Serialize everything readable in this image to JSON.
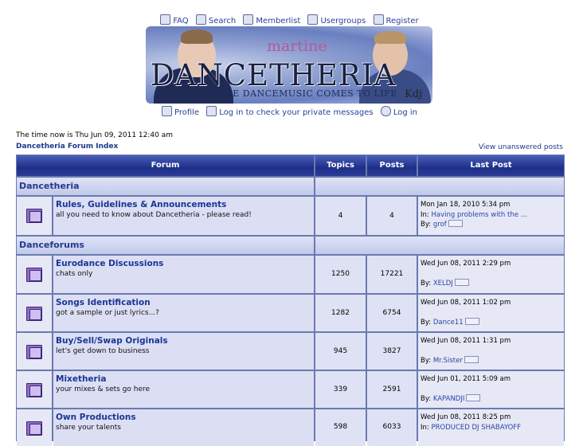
{
  "topnav": {
    "row1": {
      "faq": "FAQ",
      "search": "Search",
      "memberlist": "Memberlist",
      "usergroups": "Usergroups",
      "register": "Register"
    },
    "row2": {
      "profile": "Profile",
      "private_messages": "Log in to check your private messages",
      "login": "Log in"
    }
  },
  "banner": {
    "subtitle": "martine",
    "title": "DANCETHERIA",
    "slogan": "WHERE DANCEMUSIC COMES TO LIFE",
    "signature": "Kdj"
  },
  "page": {
    "time_now": "The time now is Thu Jun 09, 2011 12:40 am",
    "index_link": "Dancetheria Forum Index",
    "view_unanswered": "View unanswered posts"
  },
  "table": {
    "headers": {
      "forum": "Forum",
      "topics": "Topics",
      "posts": "Posts",
      "last_post": "Last Post"
    },
    "categories": [
      {
        "name": "Dancetheria",
        "forums": [
          {
            "name": "Rules, Guidelines & Announcements",
            "desc": "all you need to know about Dancetheria - please read!",
            "topics": "4",
            "posts": "4",
            "last_date": "Mon Jan 18, 2010 5:34 pm",
            "last_in_label": "In:",
            "last_in": "Having problems with the ...",
            "last_by_label": "By:",
            "last_by": "grof"
          }
        ]
      },
      {
        "name": "Danceforums",
        "forums": [
          {
            "name": "Eurodance Discussions",
            "desc": "chats only",
            "topics": "1250",
            "posts": "17221",
            "last_date": "Wed Jun 08, 2011 2:29 pm",
            "last_by_label": "By:",
            "last_by": "XELDJ"
          },
          {
            "name": "Songs Identification",
            "desc": "got a sample or just lyrics...?",
            "topics": "1282",
            "posts": "6754",
            "last_date": "Wed Jun 08, 2011 1:02 pm",
            "last_by_label": "By:",
            "last_by": "Dance11"
          },
          {
            "name": "Buy/Sell/Swap Originals",
            "desc": "let's get down to business",
            "topics": "945",
            "posts": "3827",
            "last_date": "Wed Jun 08, 2011 1:31 pm",
            "last_by_label": "By:",
            "last_by": "Mr.Sister"
          },
          {
            "name": "Mixetheria",
            "desc": "your mixes & sets go here",
            "topics": "339",
            "posts": "2591",
            "last_date": "Wed Jun 01, 2011 5:09 am",
            "last_by_label": "By:",
            "last_by": "KAPANDJI"
          },
          {
            "name": "Own Productions",
            "desc": "share your talents",
            "topics": "598",
            "posts": "6033",
            "last_date": "Wed Jun 08, 2011 8:25 pm",
            "last_in_label": "In:",
            "last_in": "PRODUCED DJ SHABAYOFF"
          }
        ]
      }
    ]
  }
}
